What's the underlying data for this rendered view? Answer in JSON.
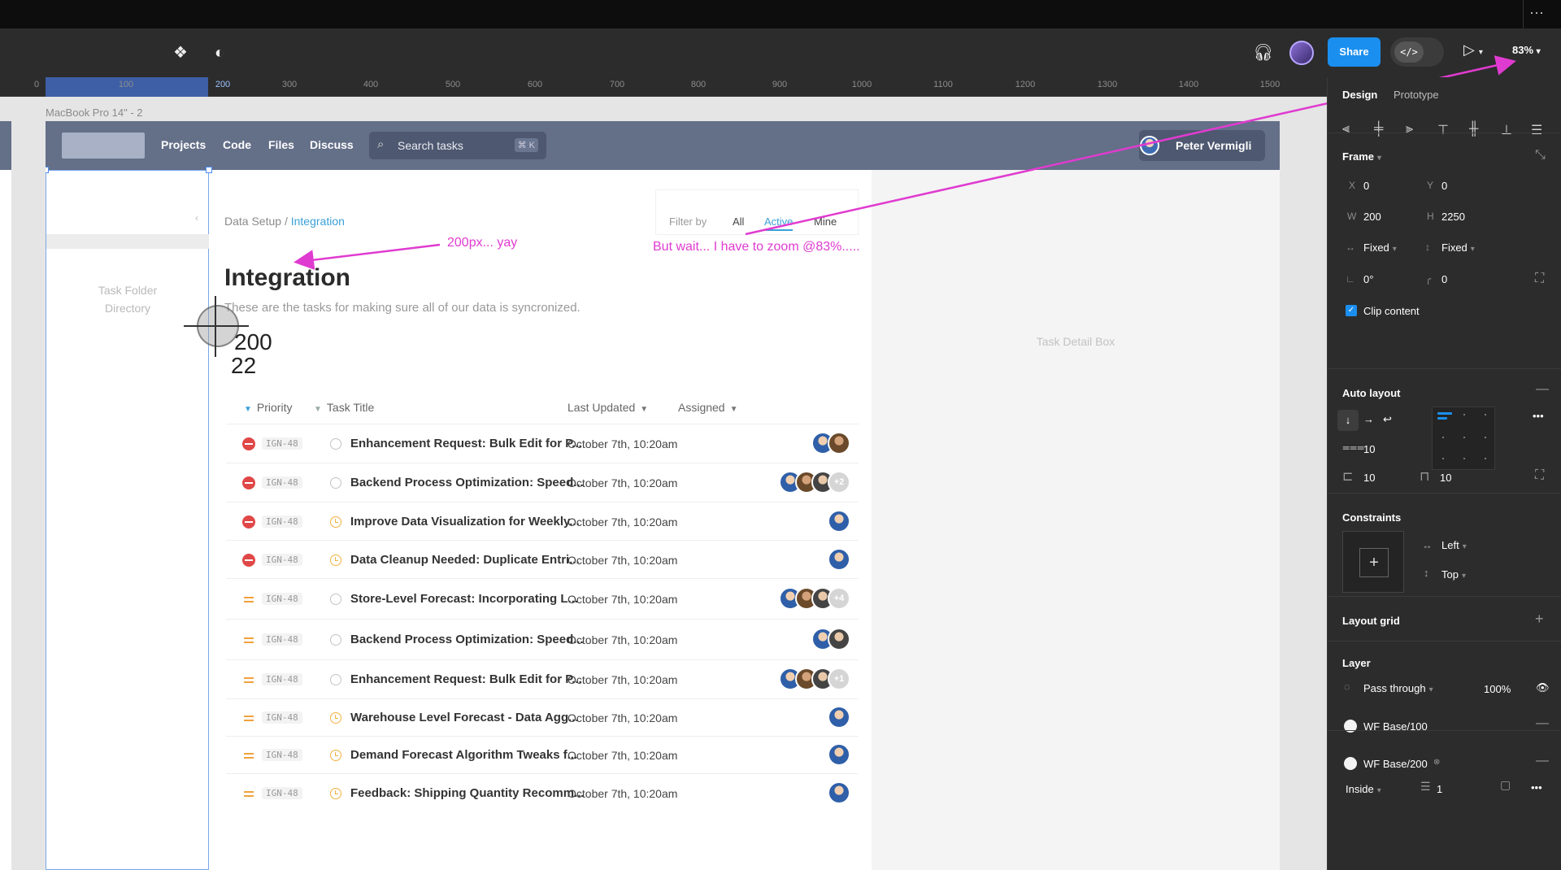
{
  "toolbar": {
    "share_label": "Share",
    "devmode_label": "</>",
    "zoom": "83%",
    "system_dots": "⋯"
  },
  "ruler": {
    "ticks": [
      "0",
      "100",
      "200",
      "300",
      "400",
      "500",
      "600",
      "700",
      "800",
      "900",
      "1000",
      "1100",
      "1200",
      "1300",
      "1400",
      "1500"
    ]
  },
  "canvas": {
    "frame_name": "MacBook Pro 14\" - 2"
  },
  "app": {
    "nav": [
      "Projects",
      "Code",
      "Files",
      "Discuss"
    ],
    "search_placeholder": "Search tasks",
    "search_shortcut": "⌘ K",
    "user_name": "Peter Vermigli",
    "left_panel_label": "Task Folder Directory",
    "task_detail_label": "Task Detail Box",
    "breadcrumb_root": "Data Setup",
    "breadcrumb_sep": "/",
    "breadcrumb_current": "Integration",
    "filter_label": "Filter by",
    "filters": [
      "All",
      "Active",
      "Mine"
    ],
    "title": "Integration",
    "subtitle": "These are the tasks for making sure all of our data is syncronized."
  },
  "table": {
    "headers": [
      "Priority",
      "Task Title",
      "Last Updated",
      "Assigned"
    ],
    "rows": [
      {
        "priority": "high",
        "id": "IGN-48",
        "status": "open",
        "title": "Enhancement Request: Bulk Edit for P...",
        "updated": "October 7th, 10:20am",
        "avatars": [
          "a1",
          "a2"
        ],
        "more": ""
      },
      {
        "priority": "high",
        "id": "IGN-48",
        "status": "open",
        "title": "Backend Process Optimization: Speed...",
        "updated": "October 7th, 10:20am",
        "avatars": [
          "a1",
          "a2",
          "a3"
        ],
        "more": "+2"
      },
      {
        "priority": "high",
        "id": "IGN-48",
        "status": "clock",
        "title": "Improve Data Visualization for Weekly...",
        "updated": "October 7th, 10:20am",
        "avatars": [
          "a1"
        ],
        "more": ""
      },
      {
        "priority": "high",
        "id": "IGN-48",
        "status": "clock",
        "title": "Data Cleanup Needed: Duplicate Entri...",
        "updated": "October 7th, 10:20am",
        "avatars": [
          "a1"
        ],
        "more": ""
      },
      {
        "priority": "med",
        "id": "IGN-48",
        "status": "open",
        "title": "Store-Level Forecast: Incorporating L...",
        "updated": "October 7th, 10:20am",
        "avatars": [
          "a1",
          "a2",
          "a3"
        ],
        "more": "+4"
      },
      {
        "priority": "med",
        "id": "IGN-48",
        "status": "open",
        "title": "Backend Process Optimization: Speed...",
        "updated": "October 7th, 10:20am",
        "avatars": [
          "a1",
          "a3"
        ],
        "more": ""
      },
      {
        "priority": "med",
        "id": "IGN-48",
        "status": "open",
        "title": "Enhancement Request: Bulk Edit for P...",
        "updated": "October 7th, 10:20am",
        "avatars": [
          "a1",
          "a2",
          "a3"
        ],
        "more": "+1"
      },
      {
        "priority": "med",
        "id": "IGN-48",
        "status": "clock",
        "title": "Warehouse Level Forecast - Data Agg...",
        "updated": "October 7th, 10:20am",
        "avatars": [
          "a1"
        ],
        "more": ""
      },
      {
        "priority": "med",
        "id": "IGN-48",
        "status": "clock",
        "title": "Demand Forecast Algorithm Tweaks f...",
        "updated": "October 7th, 10:20am",
        "avatars": [
          "a1"
        ],
        "more": ""
      },
      {
        "priority": "med",
        "id": "IGN-48",
        "status": "clock",
        "title": "Feedback: Shipping Quantity Recomm...",
        "updated": "October 7th, 10:20am",
        "avatars": [
          "a1"
        ],
        "more": ""
      }
    ]
  },
  "annotations": {
    "note1": "200px... yay",
    "note2": "But wait... I have to zoom @83%.....",
    "measure_w": "200",
    "measure_h": "22"
  },
  "panel": {
    "tabs": [
      "Design",
      "Prototype"
    ],
    "frame_title": "Frame",
    "x_label": "X",
    "x_value": "0",
    "y_label": "Y",
    "y_value": "0",
    "w_label": "W",
    "w_value": "200",
    "h_label": "H",
    "h_value": "2250",
    "w_sizing": "Fixed",
    "h_sizing": "Fixed",
    "rotation": "0°",
    "radius": "0",
    "clip_label": "Clip content",
    "autolayout_title": "Auto layout",
    "gap": "10",
    "pad_h": "10",
    "pad_v": "10",
    "constraints_title": "Constraints",
    "constraint_h": "Left",
    "constraint_v": "Top",
    "layout_grid_title": "Layout grid",
    "layer_title": "Layer",
    "blend": "Pass through",
    "opacity": "100%",
    "fill1": "WF Base/100",
    "fill2": "WF Base/200",
    "stroke_position": "Inside",
    "stroke_weight": "1"
  },
  "colors": {
    "accent": "#1b8ff0",
    "annotation": "#e03bd0",
    "navbar": "#646f88",
    "high_priority": "#e04848",
    "med_priority": "#f0a23c"
  }
}
